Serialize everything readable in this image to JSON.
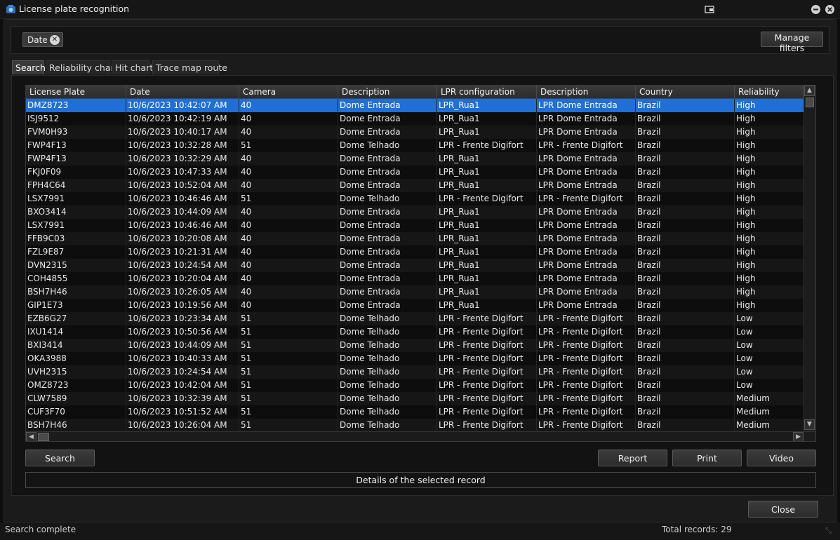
{
  "window": {
    "title": "License plate recognition"
  },
  "filter": {
    "chip_label": "Date",
    "manage_label": "Manage filters"
  },
  "tabs": [
    {
      "label": "Search",
      "active": true
    },
    {
      "label": "Reliability chart",
      "active": false
    },
    {
      "label": "Hit chart",
      "active": false
    },
    {
      "label": "Trace map route",
      "active": false
    }
  ],
  "grid": {
    "columns": [
      "License Plate",
      "Date",
      "Camera",
      "Description",
      "LPR configuration",
      "Description",
      "Country",
      "Reliability"
    ],
    "rows": [
      [
        "DMZ8723",
        "10/6/2023 10:42:07 AM",
        "40",
        "Dome Entrada",
        "LPR_Rua1",
        "LPR Dome Entrada",
        "Brazil",
        "High"
      ],
      [
        "ISJ9512",
        "10/6/2023 10:42:19 AM",
        "40",
        "Dome Entrada",
        "LPR_Rua1",
        "LPR Dome Entrada",
        "Brazil",
        "High"
      ],
      [
        "FVM0H93",
        "10/6/2023 10:40:17 AM",
        "40",
        "Dome Entrada",
        "LPR_Rua1",
        "LPR Dome Entrada",
        "Brazil",
        "High"
      ],
      [
        "FWP4F13",
        "10/6/2023 10:32:28 AM",
        "51",
        "Dome Telhado",
        "LPR - Frente Digifort",
        "LPR - Frente Digifort",
        "Brazil",
        "High"
      ],
      [
        "FWP4F13",
        "10/6/2023 10:32:29 AM",
        "40",
        "Dome Entrada",
        "LPR_Rua1",
        "LPR Dome Entrada",
        "Brazil",
        "High"
      ],
      [
        "FKJ0F09",
        "10/6/2023 10:47:33 AM",
        "40",
        "Dome Entrada",
        "LPR_Rua1",
        "LPR Dome Entrada",
        "Brazil",
        "High"
      ],
      [
        "FPH4C64",
        "10/6/2023 10:52:04 AM",
        "40",
        "Dome Entrada",
        "LPR_Rua1",
        "LPR Dome Entrada",
        "Brazil",
        "High"
      ],
      [
        "LSX7991",
        "10/6/2023 10:46:46 AM",
        "51",
        "Dome Telhado",
        "LPR - Frente Digifort",
        "LPR - Frente Digifort",
        "Brazil",
        "High"
      ],
      [
        "BXO3414",
        "10/6/2023 10:44:09 AM",
        "40",
        "Dome Entrada",
        "LPR_Rua1",
        "LPR Dome Entrada",
        "Brazil",
        "High"
      ],
      [
        "LSX7991",
        "10/6/2023 10:46:46 AM",
        "40",
        "Dome Entrada",
        "LPR_Rua1",
        "LPR Dome Entrada",
        "Brazil",
        "High"
      ],
      [
        "FFB9C03",
        "10/6/2023 10:20:08 AM",
        "40",
        "Dome Entrada",
        "LPR_Rua1",
        "LPR Dome Entrada",
        "Brazil",
        "High"
      ],
      [
        "FZL9E87",
        "10/6/2023 10:21:31 AM",
        "40",
        "Dome Entrada",
        "LPR_Rua1",
        "LPR Dome Entrada",
        "Brazil",
        "High"
      ],
      [
        "DVN2315",
        "10/6/2023 10:24:54 AM",
        "40",
        "Dome Entrada",
        "LPR_Rua1",
        "LPR Dome Entrada",
        "Brazil",
        "High"
      ],
      [
        "COH4855",
        "10/6/2023 10:20:04 AM",
        "40",
        "Dome Entrada",
        "LPR_Rua1",
        "LPR Dome Entrada",
        "Brazil",
        "High"
      ],
      [
        "BSH7H46",
        "10/6/2023 10:26:05 AM",
        "40",
        "Dome Entrada",
        "LPR_Rua1",
        "LPR Dome Entrada",
        "Brazil",
        "High"
      ],
      [
        "GIP1E73",
        "10/6/2023 10:19:56 AM",
        "40",
        "Dome Entrada",
        "LPR_Rua1",
        "LPR Dome Entrada",
        "Brazil",
        "High"
      ],
      [
        "EZB6G27",
        "10/6/2023 10:23:34 AM",
        "51",
        "Dome Telhado",
        "LPR - Frente Digifort",
        "LPR - Frente Digifort",
        "Brazil",
        "Low"
      ],
      [
        "IXU1414",
        "10/6/2023 10:50:56 AM",
        "51",
        "Dome Telhado",
        "LPR - Frente Digifort",
        "LPR - Frente Digifort",
        "Brazil",
        "Low"
      ],
      [
        "BXI3414",
        "10/6/2023 10:44:09 AM",
        "51",
        "Dome Telhado",
        "LPR - Frente Digifort",
        "LPR - Frente Digifort",
        "Brazil",
        "Low"
      ],
      [
        "OKA3988",
        "10/6/2023 10:40:33 AM",
        "51",
        "Dome Telhado",
        "LPR - Frente Digifort",
        "LPR - Frente Digifort",
        "Brazil",
        "Low"
      ],
      [
        "UVH2315",
        "10/6/2023 10:24:54 AM",
        "51",
        "Dome Telhado",
        "LPR - Frente Digifort",
        "LPR - Frente Digifort",
        "Brazil",
        "Low"
      ],
      [
        "OMZ8723",
        "10/6/2023 10:42:04 AM",
        "51",
        "Dome Telhado",
        "LPR - Frente Digifort",
        "LPR - Frente Digifort",
        "Brazil",
        "Low"
      ],
      [
        "CLW7589",
        "10/6/2023 10:32:39 AM",
        "51",
        "Dome Telhado",
        "LPR - Frente Digifort",
        "LPR - Frente Digifort",
        "Brazil",
        "Medium"
      ],
      [
        "CUF3F70",
        "10/6/2023 10:51:52 AM",
        "51",
        "Dome Telhado",
        "LPR - Frente Digifort",
        "LPR - Frente Digifort",
        "Brazil",
        "Medium"
      ],
      [
        "BSH7H46",
        "10/6/2023 10:26:04 AM",
        "51",
        "Dome Telhado",
        "LPR - Frente Digifort",
        "LPR - Frente Digifort",
        "Brazil",
        "Medium"
      ]
    ]
  },
  "buttons": {
    "search": "Search",
    "report": "Report",
    "print": "Print",
    "video": "Video",
    "details": "Details of the selected record",
    "close": "Close"
  },
  "status": {
    "left": "Search complete",
    "right": "Total records: 29"
  },
  "colors": {
    "selection": "#1f6fd6",
    "background": "#1b1b1b"
  }
}
